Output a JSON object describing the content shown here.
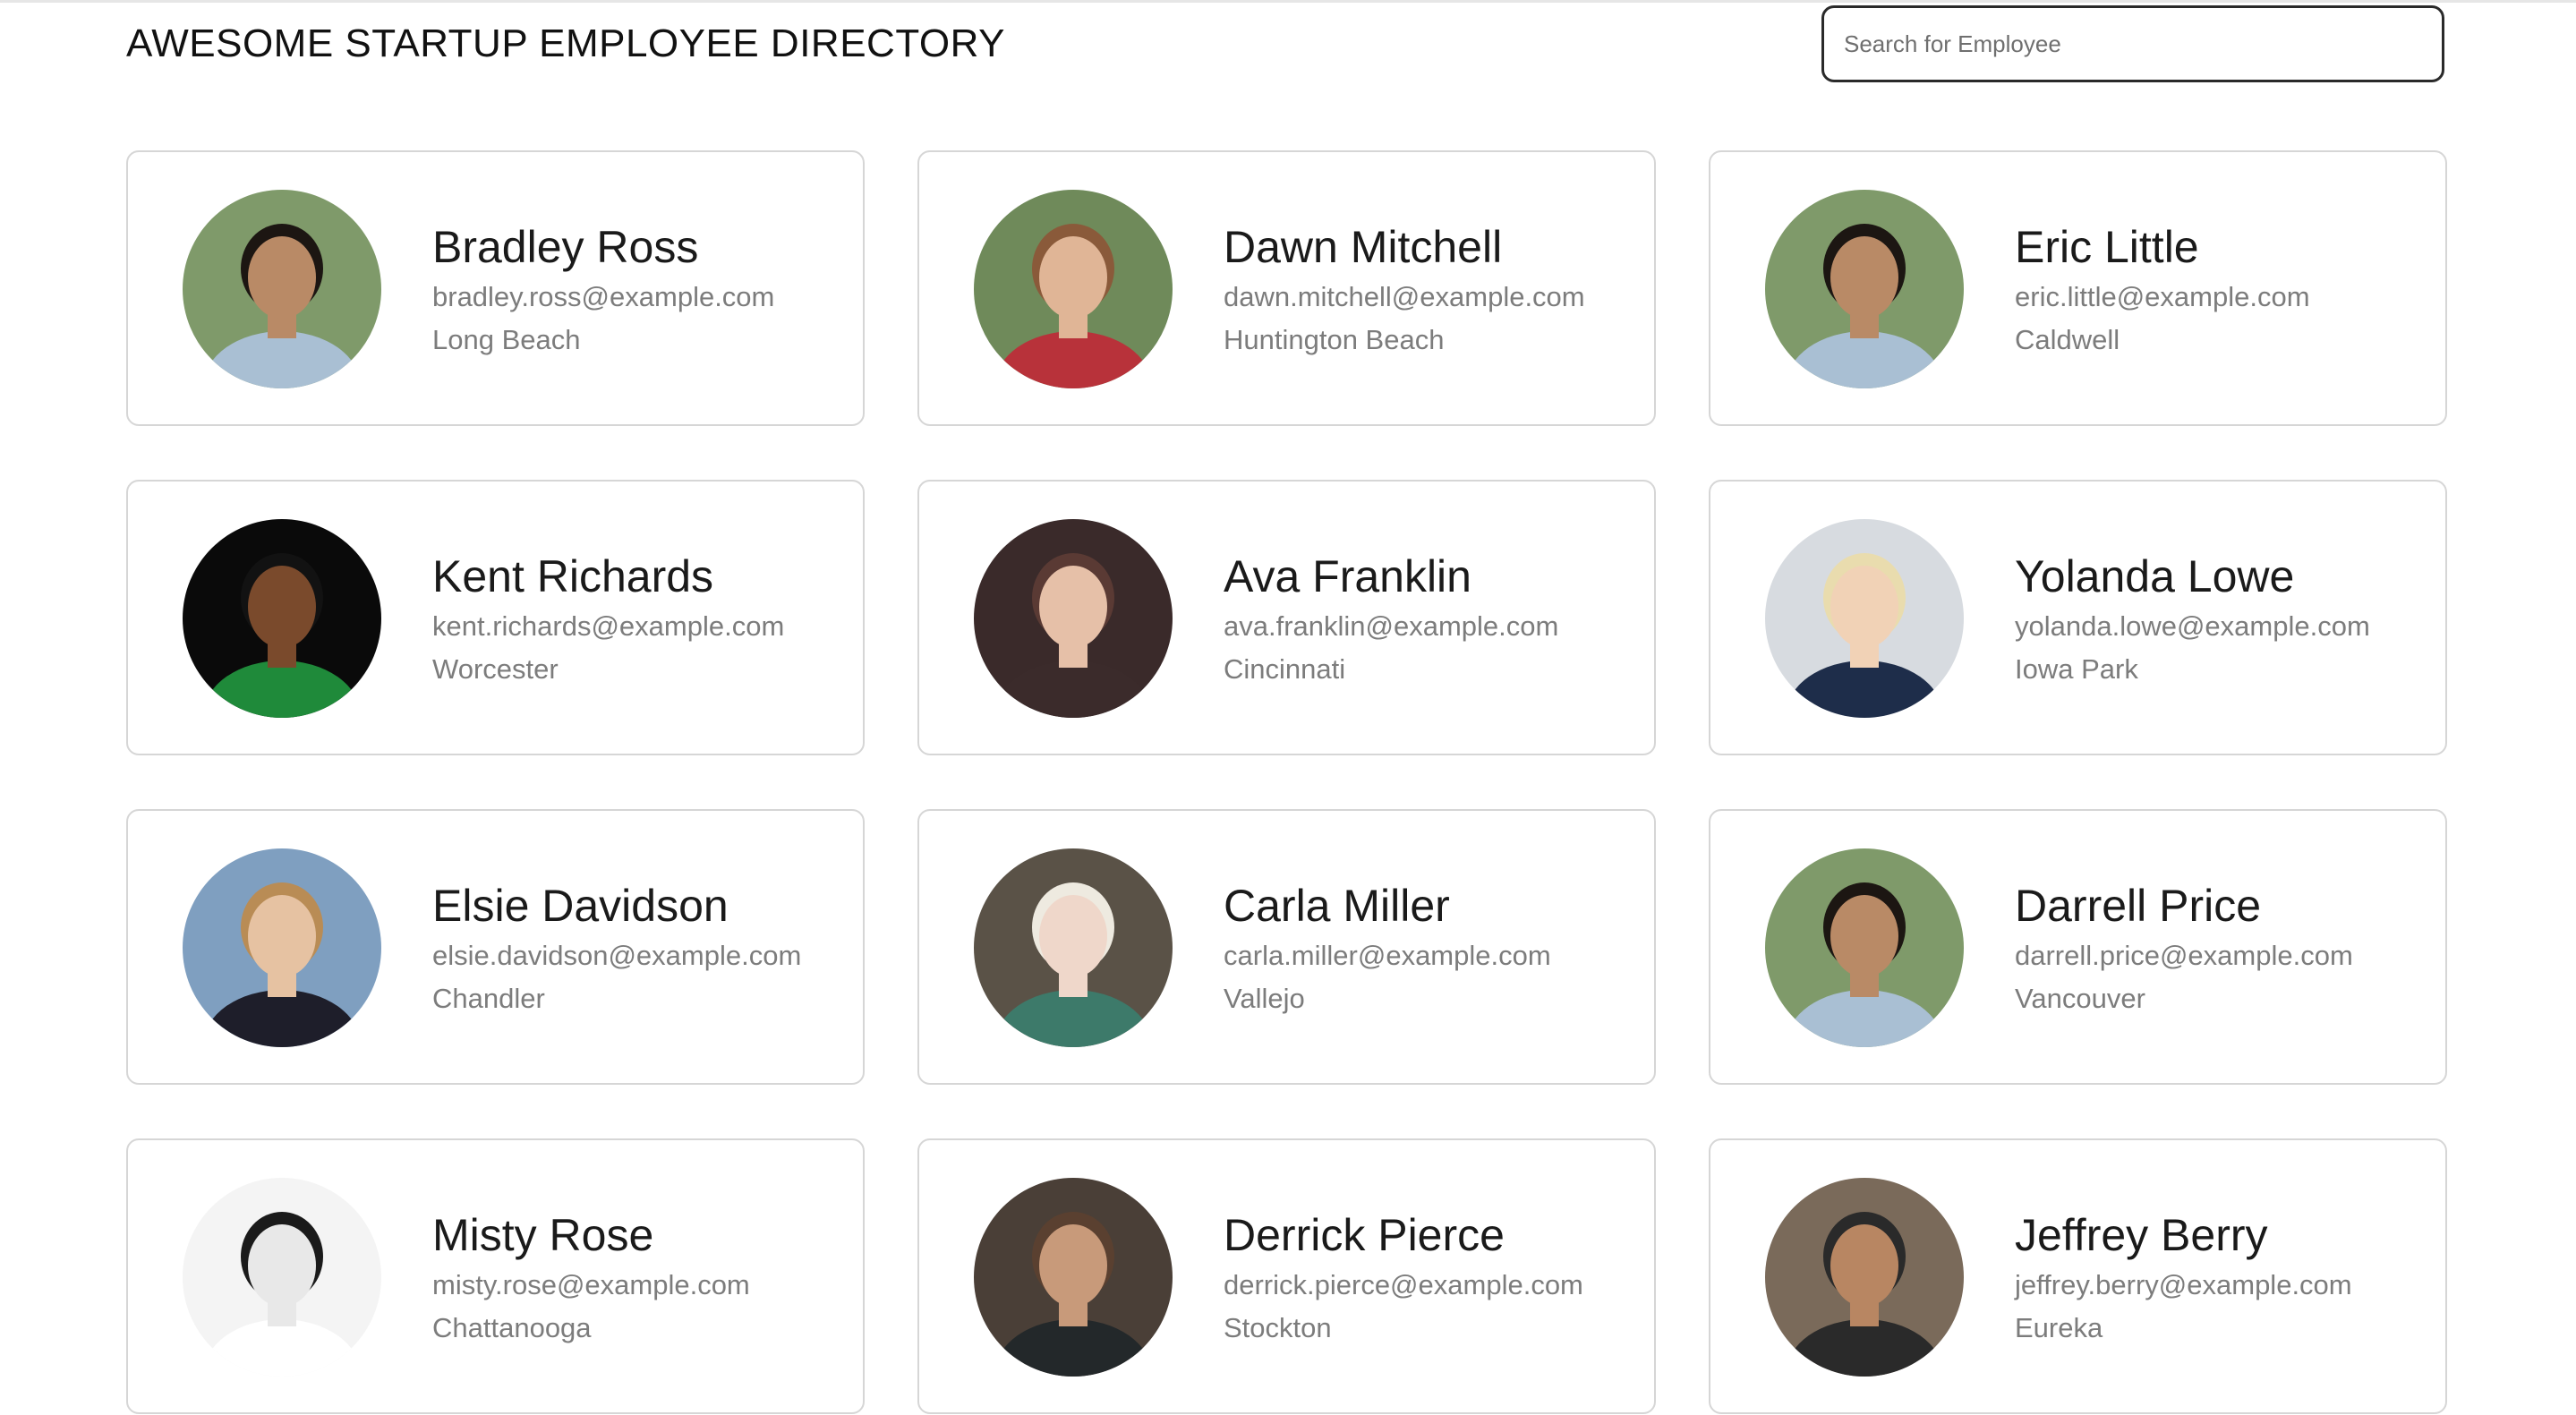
{
  "header": {
    "title": "AWESOME STARTUP EMPLOYEE DIRECTORY",
    "search_placeholder": "Search for Employee"
  },
  "employees": [
    {
      "name": "Bradley Ross",
      "email": "bradley.ross@example.com",
      "city": "Long Beach",
      "avatar_bg": "#7f9a6a",
      "skin": "#b98a66",
      "hair": "#1c1612",
      "shirt": "#a9bfd3"
    },
    {
      "name": "Dawn Mitchell",
      "email": "dawn.mitchell@example.com",
      "city": "Huntington Beach",
      "avatar_bg": "#6f8a5a",
      "skin": "#e0b596",
      "hair": "#8a5a3a",
      "shirt": "#b8323a"
    },
    {
      "name": "Eric Little",
      "email": "eric.little@example.com",
      "city": "Caldwell",
      "avatar_bg": "#7f9a6a",
      "skin": "#b98a66",
      "hair": "#1c1612",
      "shirt": "#a9bfd3"
    },
    {
      "name": "Kent Richards",
      "email": "kent.richards@example.com",
      "city": "Worcester",
      "avatar_bg": "#0a0a0a",
      "skin": "#7a4a2c",
      "hair": "#121212",
      "shirt": "#1f8a3a"
    },
    {
      "name": "Ava Franklin",
      "email": "ava.franklin@example.com",
      "city": "Cincinnati",
      "avatar_bg": "#3a2a2a",
      "skin": "#e6c0a8",
      "hair": "#5a3a34",
      "shirt": "#3b2b2b"
    },
    {
      "name": "Yolanda Lowe",
      "email": "yolanda.lowe@example.com",
      "city": "Iowa Park",
      "avatar_bg": "#d7dbe0",
      "skin": "#f1d2b6",
      "hair": "#e9dcae",
      "shirt": "#1e2d4a"
    },
    {
      "name": "Elsie Davidson",
      "email": "elsie.davidson@example.com",
      "city": "Chandler",
      "avatar_bg": "#7f9fc0",
      "skin": "#e6c2a2",
      "hair": "#b98c55",
      "shirt": "#1e1e2a"
    },
    {
      "name": "Carla Miller",
      "email": "carla.miller@example.com",
      "city": "Vallejo",
      "avatar_bg": "#5a5247",
      "skin": "#efd7ca",
      "hair": "#eeeae0",
      "shirt": "#3d7a6a"
    },
    {
      "name": "Darrell Price",
      "email": "darrell.price@example.com",
      "city": "Vancouver",
      "avatar_bg": "#7f9a6a",
      "skin": "#b98a66",
      "hair": "#1c1612",
      "shirt": "#a9bfd3"
    },
    {
      "name": "Misty Rose",
      "email": "misty.rose@example.com",
      "city": "Chattanooga",
      "avatar_bg": "#f4f4f4",
      "skin": "#e8e8e8",
      "hair": "#1a1a1a",
      "shirt": "#ffffff"
    },
    {
      "name": "Derrick Pierce",
      "email": "derrick.pierce@example.com",
      "city": "Stockton",
      "avatar_bg": "#4a3f37",
      "skin": "#c89a7a",
      "hair": "#5a4030",
      "shirt": "#23282a"
    },
    {
      "name": "Jeffrey Berry",
      "email": "jeffrey.berry@example.com",
      "city": "Eureka",
      "avatar_bg": "#7a6a5a",
      "skin": "#b88662",
      "hair": "#2a2a2a",
      "shirt": "#2a2a2a"
    }
  ]
}
